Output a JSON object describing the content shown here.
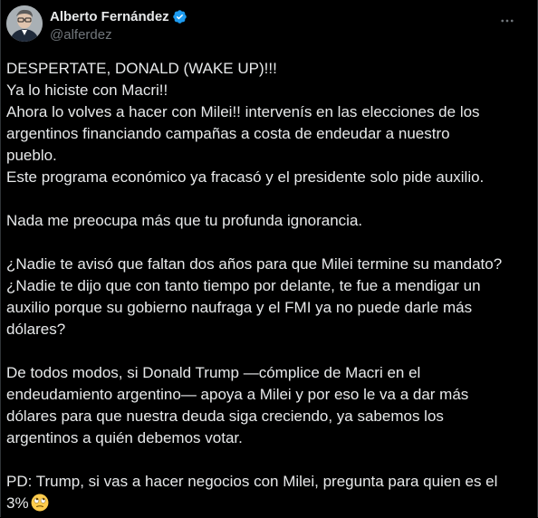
{
  "tweet": {
    "author": {
      "display_name": "Alberto Fernández",
      "handle": "@alferdez",
      "verified": true
    },
    "paragraphs": [
      [
        "DESPERTATE, DONALD (WAKE UP)!!!",
        "Ya lo hiciste con Macri!!",
        "Ahora lo volves a hacer con Milei!! intervenís en las elecciones de los",
        "argentinos financiando campañas a costa de endeudar a nuestro",
        "pueblo.",
        "Este programa económico ya fracasó y el presidente solo pide auxilio."
      ],
      [
        "Nada me preocupa más que tu profunda ignorancia."
      ],
      [
        "¿Nadie te avisó que faltan dos años para que Milei termine su mandato?",
        "¿Nadie te dijo que con tanto tiempo por delante, te fue a mendigar un",
        "auxilio porque su gobierno naufraga y el FMI ya no puede darle más",
        "dólares?"
      ],
      [
        "De todos modos, si Donald Trump —cómplice de Macri en el",
        "endeudamiento argentino— apoya a Milei y por eso le va a dar más",
        "dólares para que nuestra deuda siga creciendo, ya sabemos los",
        "argentinos a quién debemos votar."
      ],
      [
        "PD: Trump, si vas a hacer negocios con Milei, pregunta para quien es el",
        "3%"
      ]
    ],
    "trailing_emoji": "face-with-rolling-eyes-emoji"
  },
  "colors": {
    "background": "#000000",
    "text": "#e7e9ea",
    "secondary_text": "#71767b",
    "verified_badge": "#1d9bf0",
    "emoji": "#ffcc4d"
  },
  "icons": {
    "verified": "verified-badge-icon",
    "more": "more-options-icon"
  }
}
